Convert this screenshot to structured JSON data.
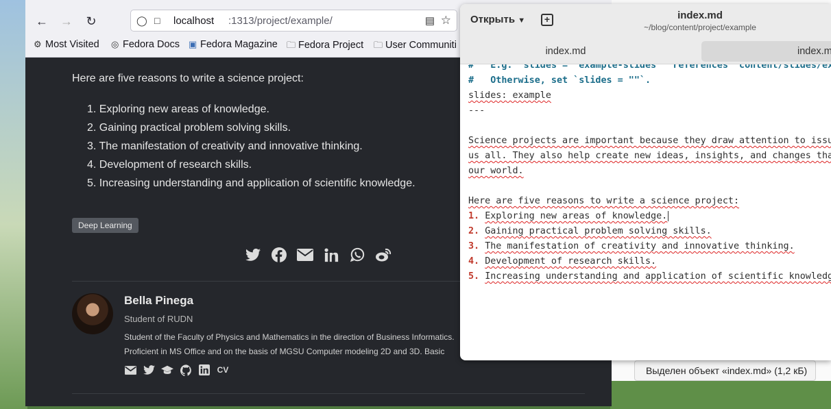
{
  "browser": {
    "url_host": "localhost",
    "url_path": ":1313/project/example/",
    "bookmarks": [
      {
        "label": "Most Visited",
        "icon": "gear-icon"
      },
      {
        "label": "Fedora Docs",
        "icon": "globe-icon"
      },
      {
        "label": "Fedora Magazine",
        "icon": "fm-icon"
      },
      {
        "label": "Fedora Project",
        "icon": "folder-icon"
      },
      {
        "label": "User Communiti",
        "icon": "folder-icon"
      }
    ]
  },
  "article": {
    "intro": "Here are five reasons to write a science project:",
    "reasons": [
      "Exploring new areas of knowledge.",
      "Gaining practical problem solving skills.",
      "The manifestation of creativity and innovative thinking.",
      "Development of research skills.",
      "Increasing understanding and application of scientific knowledge."
    ],
    "tag": "Deep Learning",
    "share_icons": [
      "twitter-icon",
      "facebook-icon",
      "email-icon",
      "linkedin-icon",
      "whatsapp-icon",
      "weibo-icon"
    ]
  },
  "author": {
    "name": "Bella Pinega",
    "role": "Student of RUDN",
    "bio": "Student of the Faculty of Physics and Mathematics in the direction of Business Informatics. Proficient in MS Office and on the basis of MGSU Computer modeling 2D and 3D. Basic knowledge of English and French.",
    "links": [
      "email-icon",
      "twitter-icon",
      "graduation-cap-icon",
      "github-icon",
      "linkedin-icon"
    ],
    "cv_label": "CV"
  },
  "editor": {
    "open_label": "Открыть",
    "title": "index.md",
    "path": "~/blog/content/project/example",
    "tabs": [
      "index.md",
      "index.m"
    ],
    "lines": {
      "l0": "#   E.g. `slides = \"example-slides\"` references `content/slides/ex",
      "l1": "#   Otherwise, set `slides = \"\"`.",
      "l2": "slides: example",
      "l3": "---",
      "l5": "Science projects are important because they draw attention to issu",
      "l6": "us all. They also help create new ideas, insights, and changes tha",
      "l7": "our world.",
      "l9": "Here are five reasons to write a science project:",
      "n1": "1.",
      "t1": "Exploring new areas of knowledge.",
      "n2": "2.",
      "t2": "Gaining practical problem solving skills.",
      "n3": "3.",
      "t3": "The manifestation of creativity and innovative thinking.",
      "n4": "4.",
      "t4": "Development of research skills.",
      "n5": "5.",
      "t5": "Increasing understanding and application of scientific knowledg"
    }
  },
  "file_manager": {
    "status": "Выделен объект «index.md»  (1,2 кБ)"
  }
}
